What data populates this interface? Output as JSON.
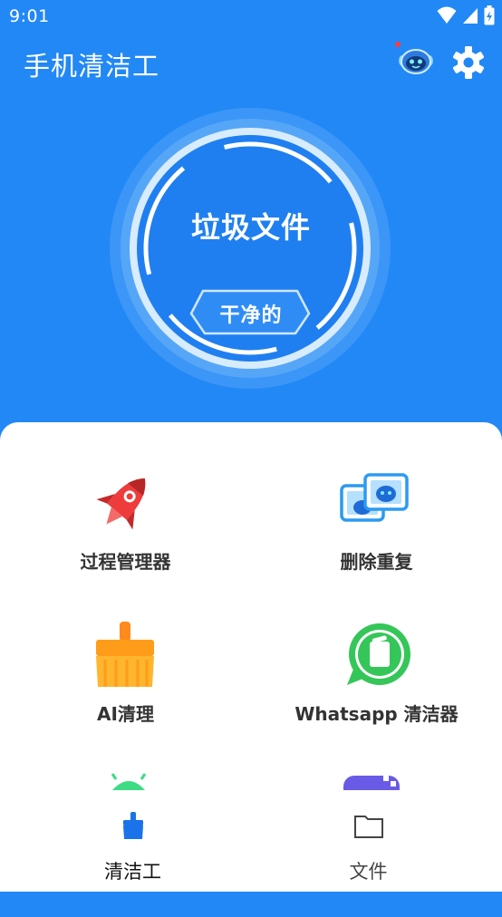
{
  "status_bar": {
    "time": "9:01"
  },
  "header": {
    "title": "手机清洁工",
    "notification_dot_color": "#ff3b3b"
  },
  "hero": {
    "title": "垃圾文件",
    "status": "干净的"
  },
  "features": [
    {
      "label": "过程管理器",
      "icon": "rocket-icon"
    },
    {
      "label": "删除重复",
      "icon": "duplicate-photos-icon"
    },
    {
      "label": "AI清理",
      "icon": "broom-icon"
    },
    {
      "label": "Whatsapp 清洁器",
      "icon": "whatsapp-trash-icon"
    },
    {
      "icon": "android-icon"
    },
    {
      "icon": "game-controller-icon"
    }
  ],
  "bottom_nav": [
    {
      "label": "清洁工",
      "active": true
    },
    {
      "label": "文件",
      "active": false
    }
  ],
  "colors": {
    "primary": "#2288f5",
    "active_tab": "#1a73e8",
    "text": "#333333"
  }
}
